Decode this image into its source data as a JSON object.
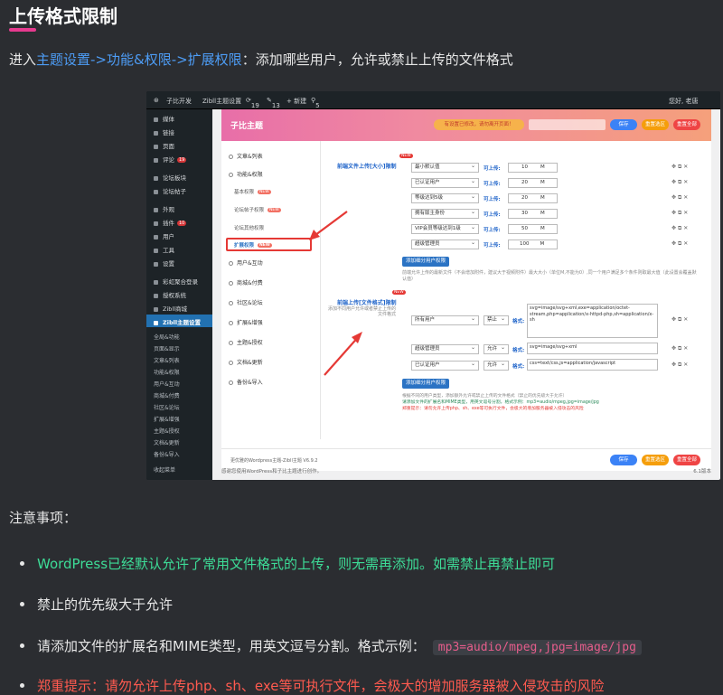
{
  "heading": "上传格式限制",
  "intro": {
    "prefix": "进入",
    "path": "主题设置->功能&权限->扩展权限",
    "suffix": "：添加哪些用户，允许或禁止上传的文件格式"
  },
  "screenshot": {
    "topbar": {
      "site": "子比开发",
      "theme": "Zibll主题设置",
      "comments": "19",
      "updates": "13",
      "new": "+ 新建",
      "links": "5",
      "user": "您好, 老唐"
    },
    "sidebar": [
      {
        "label": "媒体"
      },
      {
        "label": "链接"
      },
      {
        "label": "页面"
      },
      {
        "label": "评论",
        "badge": "19"
      },
      {
        "label": "论坛板块"
      },
      {
        "label": "论坛帖子"
      },
      {
        "label": "外观"
      },
      {
        "label": "插件",
        "badge": "10"
      },
      {
        "label": "用户"
      },
      {
        "label": "工具"
      },
      {
        "label": "设置"
      },
      {
        "label": "彩虹聚合登录"
      },
      {
        "label": "授权系统"
      },
      {
        "label": "Zibll商城"
      },
      {
        "label": "Zibll主题设置"
      }
    ],
    "sidebar_sub": [
      "全局&功能",
      "页面&显示",
      "文章&列表",
      "功能&权限",
      "用户&互动",
      "商城&付费",
      "社区&论坛",
      "扩展&增强",
      "主题&授权",
      "文档&更新",
      "备份&导入",
      "收起菜单"
    ],
    "theme_title": "子比主题",
    "notice": "有设置已修改，请勿离开页面！",
    "buttons": {
      "save": "保存",
      "reset": "重置选区",
      "backup": "重置全部"
    },
    "menu": {
      "items": [
        "文章&列表",
        "功能&权限"
      ],
      "sub": [
        {
          "label": "基本权限",
          "tag": "NEW"
        },
        {
          "label": "论坛帖子权限",
          "tag": "NEW"
        },
        {
          "label": "论坛其他权限"
        },
        {
          "label": "扩展权限",
          "tag": "NEW"
        }
      ],
      "more": [
        "用户&互动",
        "商城&付费",
        "社区&论坛",
        "扩展&增强",
        "主题&授权",
        "文档&更新",
        "备份&导入"
      ]
    },
    "section1": {
      "label": "前端文件上传[大小]限制",
      "new": "NEW",
      "rows": [
        {
          "user": "最小默认值",
          "label": "可上传:",
          "value": "10",
          "unit": "M"
        },
        {
          "user": "已认证用户",
          "label": "可上传:",
          "value": "20",
          "unit": "M"
        },
        {
          "user": "等级达到5级",
          "label": "可上传:",
          "value": "20",
          "unit": "M"
        },
        {
          "user": "拥有版主身份",
          "label": "可上传:",
          "value": "30",
          "unit": "M"
        },
        {
          "user": "VIP会员等级达到1级",
          "label": "可上传:",
          "value": "50",
          "unit": "M"
        },
        {
          "user": "超级管理员",
          "label": "可上传:",
          "value": "100",
          "unit": "M"
        }
      ],
      "add_button": "添加细分用户权限",
      "desc": "前端允许上传的最新文件（不会增加附件，建议大于视频附件）最大大小（单位M,不能为0）,同一个用户满足多个条件则取最大值（此设置会覆盖默认值）"
    },
    "section2": {
      "label": "前端上传[文件格式]限制",
      "new": "NEW",
      "desc": "添加不同用户允许或者禁止上传的文件格式",
      "rows": [
        {
          "user": "所有用户",
          "mode": "禁止",
          "label": "格式:",
          "value": "svg=image/svg+xml,exe=application/octet-stream,php=application/x-httpd-php,sh=application/x-sh"
        },
        {
          "user": "超级管理员",
          "mode": "允许",
          "label": "格式:",
          "value": "svg=image/svg+xml"
        },
        {
          "user": "已认证用户",
          "mode": "允许",
          "label": "格式:",
          "value": "css=text/css,js=application/javascript"
        }
      ],
      "add_button": "添加细分用户权限",
      "note1": "根据不同的用户类型，添加额外允许或禁止上传的文件格式（禁止的优先级大于允许）",
      "note2": "请添加文件的扩展名和MIME类型，用英文逗号分割，格式示例：mp3=audio/mpeg,jpg=image/jpg",
      "note3": "郑重提示：请勿允许上传php、sh、exe等可执行文件，会极大的增加服务器被入侵攻击的风险"
    },
    "footer_text": "更优雅的Wordpress主题-Zibll主题 V6.9.2",
    "wp_credit": "感谢您使用WordPress和子比主题进行创作。",
    "wp_version": "6.1版本"
  },
  "notes_title": "注意事项：",
  "notes": [
    {
      "text": "WordPress已经默认允许了常用文件格式的上传，则无需再添加。如需禁止再禁止即可"
    },
    {
      "text": "禁止的优先级大于允许"
    },
    {
      "text": "请添加文件的扩展名和MIME类型，用英文逗号分割。格式示例：",
      "code": "mp3=audio/mpeg,jpg=image/jpg"
    },
    {
      "text": "郑重提示：请勿允许上传php、sh、exe等可执行文件，会极大的增加服务器被入侵攻击的风险"
    }
  ],
  "colors": {
    "accent": "#e73a8f",
    "link": "#4d9cf5",
    "green": "#3ddc97",
    "red": "#ff5a4f",
    "code": "#e55d8b"
  }
}
